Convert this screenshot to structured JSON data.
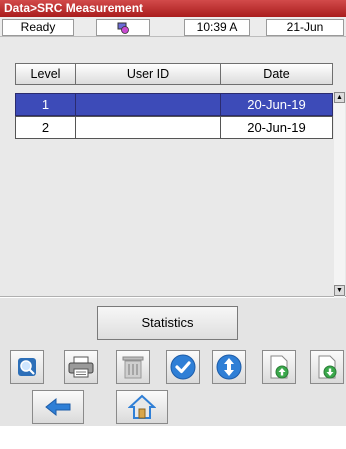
{
  "window": {
    "title": "Data>SRC Measurement"
  },
  "status": {
    "state": "Ready",
    "time": "10:39 A",
    "date": "21-Jun"
  },
  "table": {
    "headers": [
      "Level",
      "User ID",
      "Date"
    ],
    "rows": [
      {
        "level": "1",
        "user_id": "",
        "date": "20-Jun-19",
        "selected": true
      },
      {
        "level": "2",
        "user_id": "",
        "date": "20-Jun-19",
        "selected": false
      }
    ]
  },
  "buttons": {
    "statistics": "Statistics"
  },
  "icons": {
    "status": "network-icon",
    "toolbar": [
      "magnify-icon",
      "print-icon",
      "trash-icon",
      "checkmark-icon",
      "sort-icon",
      "export-icon",
      "import-icon"
    ],
    "nav": [
      "back-arrow-icon",
      "home-icon"
    ]
  },
  "colors": {
    "title_bar": "#b82828",
    "selection": "#3d4bb8",
    "icon_blue": "#2f7fd6",
    "icon_green": "#3aa84b"
  }
}
